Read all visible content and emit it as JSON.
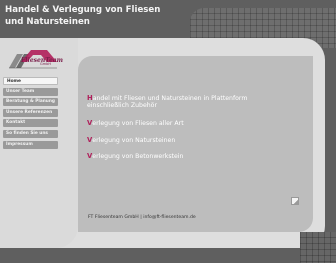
{
  "header": {
    "title_line1": "Handel & Verlegung von Fliesen",
    "title_line2": "und Natursteinen"
  },
  "logo": {
    "text": "FliesenTeam",
    "sub": "GmbH"
  },
  "nav": {
    "items": [
      {
        "label": "Home",
        "active": true
      },
      {
        "label": "Unser Team"
      },
      {
        "label": "Beratung & Planung"
      },
      {
        "label": "Unsere Referenzen"
      },
      {
        "label": "Kontakt"
      },
      {
        "label": "So finden Sie uns"
      },
      {
        "label": "Impressum"
      }
    ]
  },
  "content": {
    "lines": [
      {
        "first": "H",
        "rest": "andel mit Fliesen und Natursteinen in Plattenform"
      },
      {
        "first": "",
        "rest": "einschließlich Zubehör"
      },
      {
        "first": "V",
        "rest": "erlegung von Fliesen aller Art"
      },
      {
        "first": "V",
        "rest": "erlegung von Natursteinen"
      },
      {
        "first": "V",
        "rest": "erlegung von  Betonwerkstein"
      }
    ],
    "footer": "FT Fliesenteam GmbH | info@ft-fliesenteam.de"
  },
  "colors": {
    "accent": "#b01e5a",
    "background": "#5f5f5f",
    "panel": "#dedede",
    "content": "#bdbdbd"
  }
}
